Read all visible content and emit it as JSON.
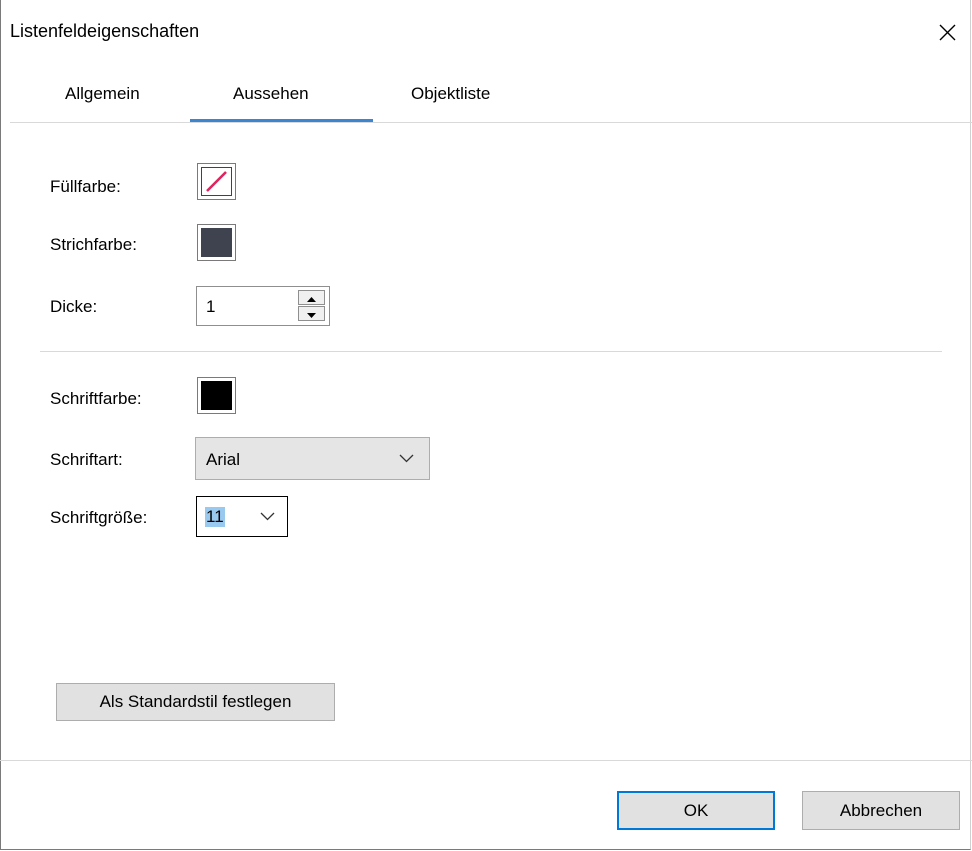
{
  "window": {
    "title": "Listenfeldeigenschaften",
    "close_icon": "close-icon"
  },
  "tabs": [
    {
      "label": "Allgemein",
      "selected": false
    },
    {
      "label": "Aussehen",
      "selected": true
    },
    {
      "label": "Objektliste",
      "selected": false
    }
  ],
  "appearance": {
    "fill_color_label": "Füllfarbe:",
    "fill_color_value": "none",
    "stroke_color_label": "Strichfarbe:",
    "stroke_color_value": "#3f4350",
    "thickness_label": "Dicke:",
    "thickness_value": "1"
  },
  "font": {
    "color_label": "Schriftfarbe:",
    "color_value": "#000000",
    "family_label": "Schriftart:",
    "family_value": "Arial",
    "size_label": "Schriftgröße:",
    "size_value": "11"
  },
  "buttons": {
    "set_default_style": "Als Standardstil festlegen",
    "ok": "OK",
    "cancel": "Abbrechen"
  },
  "colors": {
    "accent": "#0078d7",
    "tab_underline": "#3b86d3",
    "no_fill_slash": "#e0245e",
    "selection_highlight": "#99c9ef"
  }
}
